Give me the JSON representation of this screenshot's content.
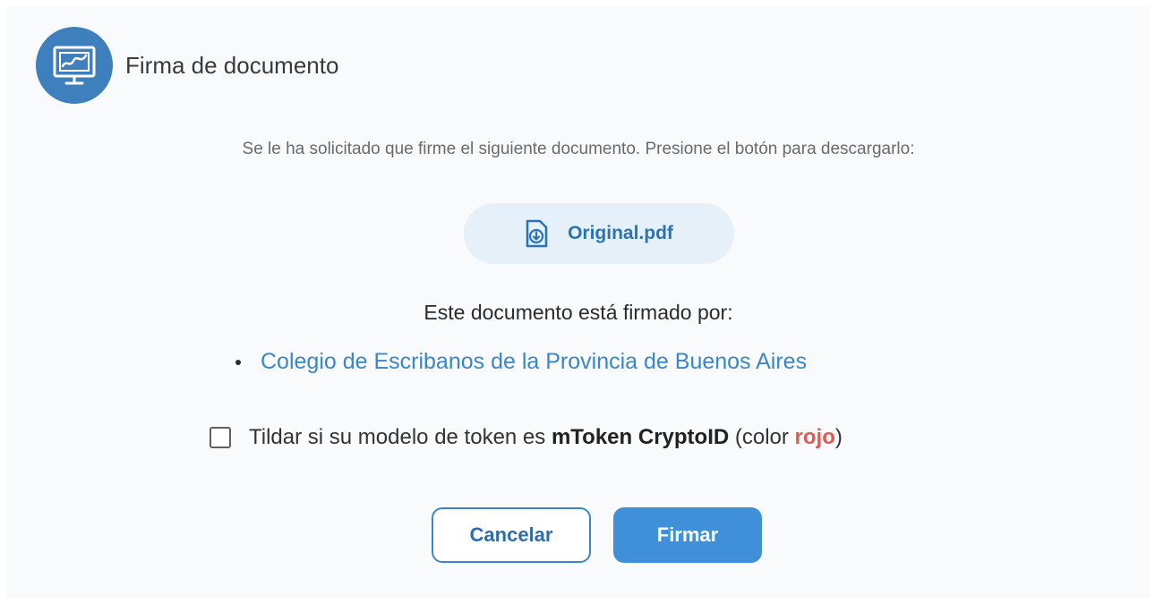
{
  "dialog": {
    "title": "Firma de documento",
    "logo_icon": "signature-monitor-icon",
    "intro_text": "Se le ha solicitado que firme el siguiente documento. Presione el botón para descargarlo:"
  },
  "file": {
    "name": "Original.pdf",
    "icon": "file-download-icon"
  },
  "signed_by": {
    "heading": "Este documento está firmado por:",
    "signers": [
      "Colegio de Escribanos de la Provincia de Buenos Aires"
    ]
  },
  "token_option": {
    "checked": false,
    "text_before": "Tildar si su modelo de token es",
    "model": "mToken CryptoID",
    "text_middle": "(color",
    "color_word": "rojo",
    "text_after": ")"
  },
  "actions": {
    "cancel_label": "Cancelar",
    "sign_label": "Firmar"
  },
  "colors": {
    "accent": "#3f8fd9",
    "link": "#3a86cc",
    "warning_red": "#e05a4f",
    "pill_bg": "#e6f0f8"
  }
}
